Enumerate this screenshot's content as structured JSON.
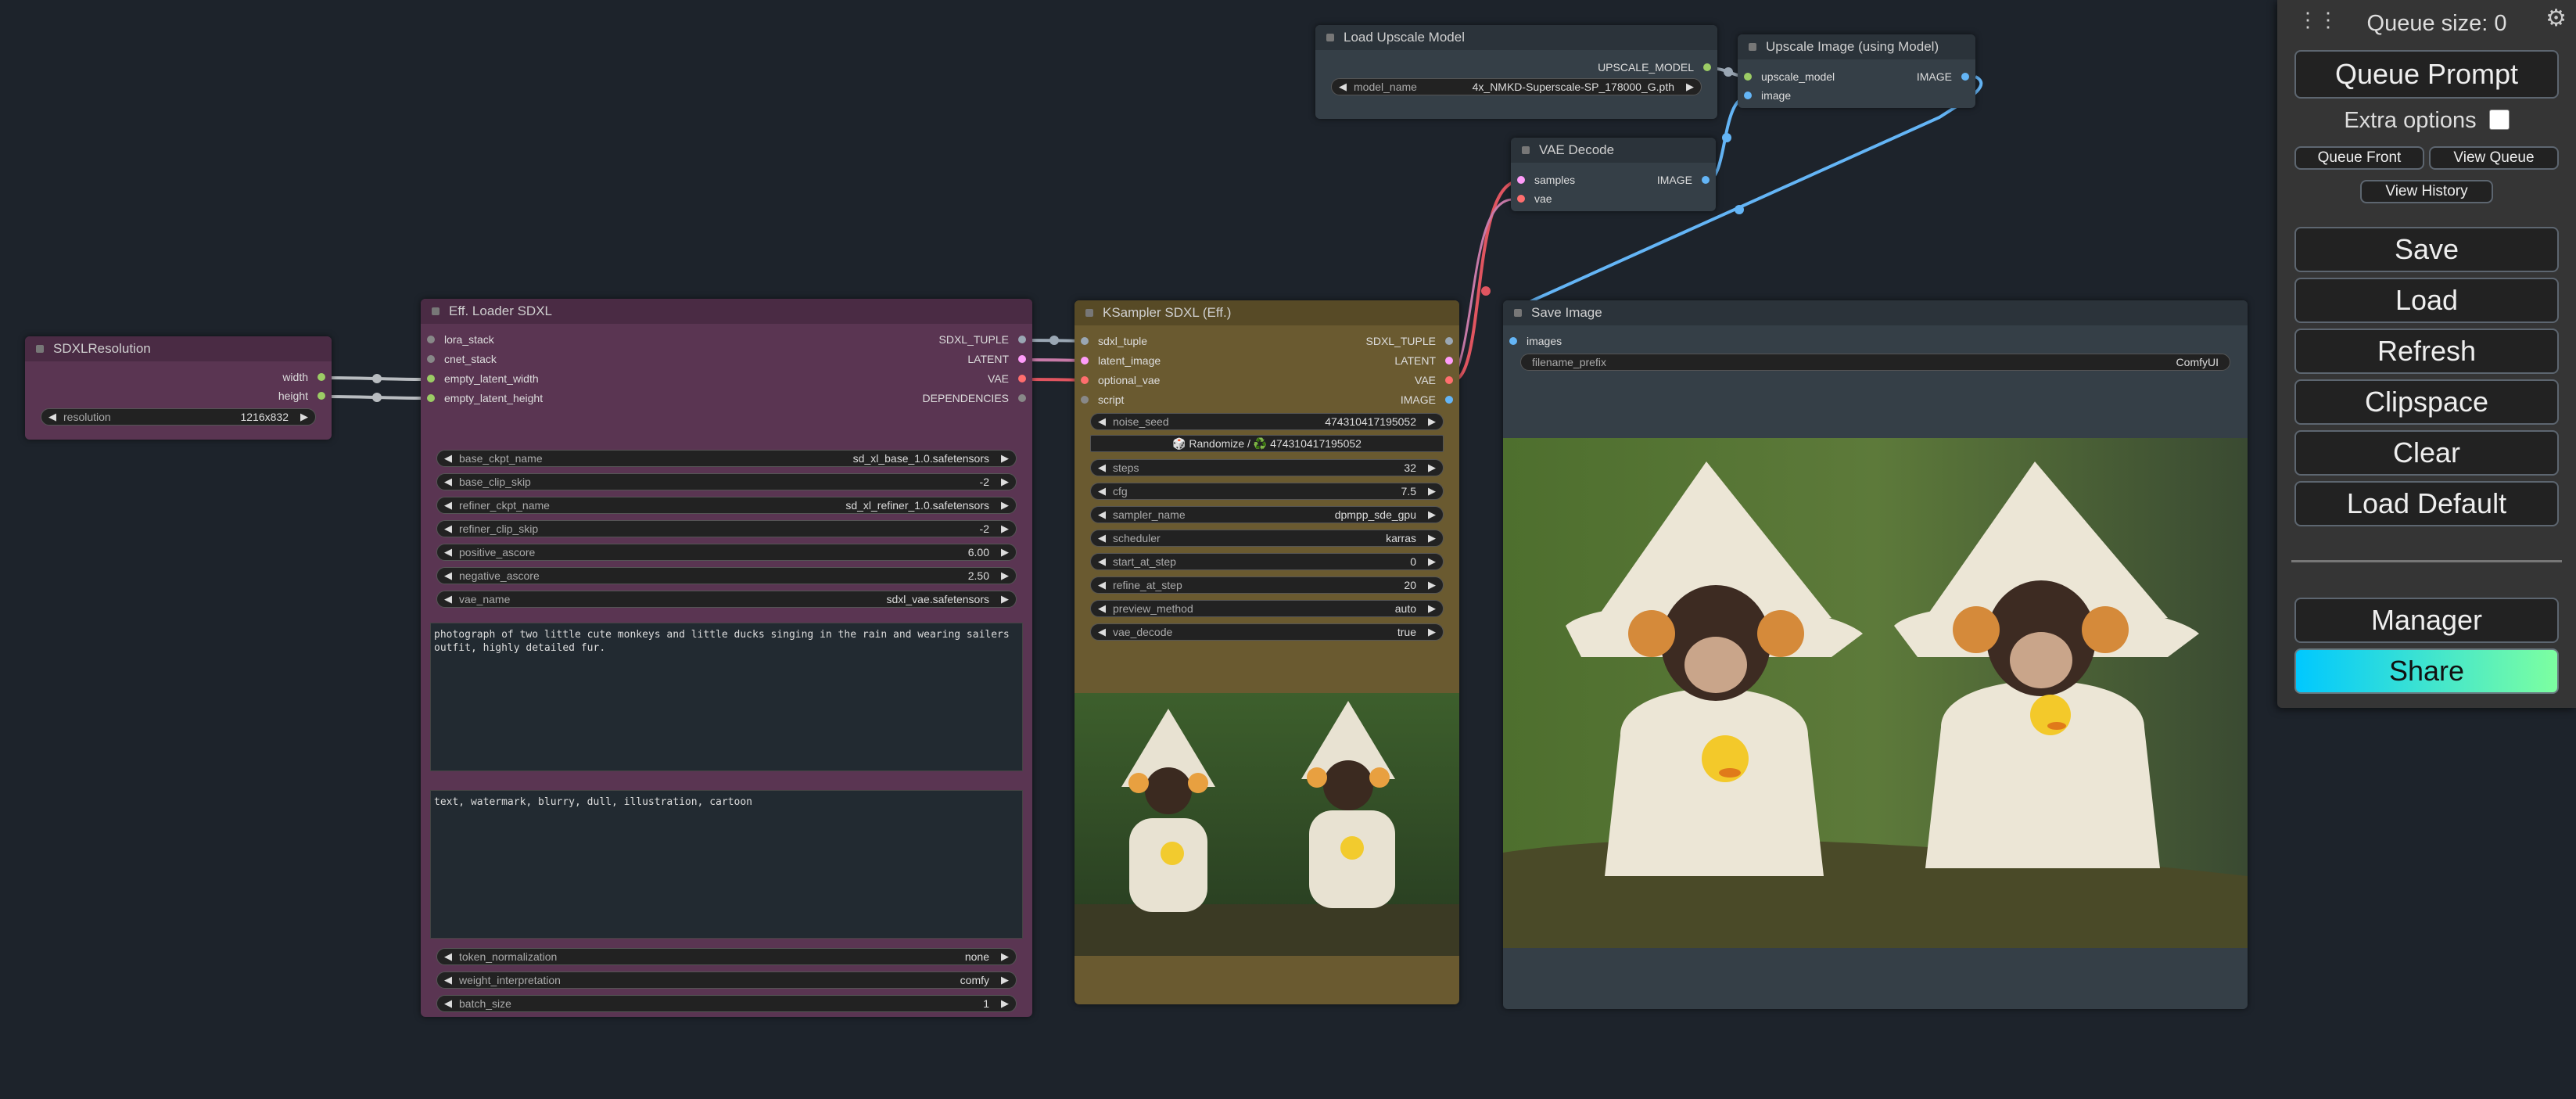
{
  "nodes": {
    "sdxl_resolution": {
      "title": "SDXLResolution",
      "outputs": [
        "width",
        "height"
      ],
      "widget": {
        "label": "resolution",
        "value": "1216x832"
      }
    },
    "eff_loader": {
      "title": "Eff. Loader SDXL",
      "inputs": [
        "lora_stack",
        "cnet_stack",
        "empty_latent_width",
        "empty_latent_height"
      ],
      "outputs": [
        "SDXL_TUPLE",
        "LATENT",
        "VAE",
        "DEPENDENCIES"
      ],
      "widgets": [
        {
          "label": "base_ckpt_name",
          "value": "sd_xl_base_1.0.safetensors"
        },
        {
          "label": "base_clip_skip",
          "value": "-2"
        },
        {
          "label": "refiner_ckpt_name",
          "value": "sd_xl_refiner_1.0.safetensors"
        },
        {
          "label": "refiner_clip_skip",
          "value": "-2"
        },
        {
          "label": "positive_ascore",
          "value": "6.00"
        },
        {
          "label": "negative_ascore",
          "value": "2.50"
        },
        {
          "label": "vae_name",
          "value": "sdxl_vae.safetensors"
        }
      ],
      "positive_prompt": "photograph of two little cute monkeys and little ducks singing in the rain and wearing sailers outfit, highly detailed fur.",
      "negative_prompt": "text, watermark, blurry, dull, illustration, cartoon",
      "widgets_bottom": [
        {
          "label": "token_normalization",
          "value": "none"
        },
        {
          "label": "weight_interpretation",
          "value": "comfy"
        },
        {
          "label": "batch_size",
          "value": "1"
        }
      ]
    },
    "ksampler": {
      "title": "KSampler SDXL (Eff.)",
      "inputs": [
        "sdxl_tuple",
        "latent_image",
        "optional_vae",
        "script"
      ],
      "outputs": [
        "SDXL_TUPLE",
        "LATENT",
        "VAE",
        "IMAGE"
      ],
      "seed_widget": {
        "label": "noise_seed",
        "value": "474310417195052"
      },
      "randomize_label": "🎲 Randomize / ♻️ 474310417195052",
      "widgets": [
        {
          "label": "steps",
          "value": "32"
        },
        {
          "label": "cfg",
          "value": "7.5"
        },
        {
          "label": "sampler_name",
          "value": "dpmpp_sde_gpu"
        },
        {
          "label": "scheduler",
          "value": "karras"
        },
        {
          "label": "start_at_step",
          "value": "0"
        },
        {
          "label": "refine_at_step",
          "value": "20"
        },
        {
          "label": "preview_method",
          "value": "auto"
        },
        {
          "label": "vae_decode",
          "value": "true"
        }
      ]
    },
    "load_upscale": {
      "title": "Load Upscale Model",
      "output": "UPSCALE_MODEL",
      "widget": {
        "label": "model_name",
        "value": "4x_NMKD-Superscale-SP_178000_G.pth"
      }
    },
    "upscale_image": {
      "title": "Upscale Image (using Model)",
      "inputs": [
        "upscale_model",
        "image"
      ],
      "output": "IMAGE"
    },
    "vae_decode": {
      "title": "VAE Decode",
      "inputs": [
        "samples",
        "vae"
      ],
      "output": "IMAGE"
    },
    "save_image": {
      "title": "Save Image",
      "input": "images",
      "widget": {
        "label": "filename_prefix",
        "value": "ComfyUI"
      }
    }
  },
  "menu": {
    "queue_size": "Queue size: 0",
    "queue_prompt": "Queue Prompt",
    "extra_options": "Extra options",
    "queue_front": "Queue Front",
    "view_queue": "View Queue",
    "view_history": "View History",
    "save": "Save",
    "load": "Load",
    "refresh": "Refresh",
    "clipspace": "Clipspace",
    "clear": "Clear",
    "load_default": "Load Default",
    "manager": "Manager",
    "share": "Share"
  },
  "colors": {
    "canvas": "#1d232b",
    "loader_node": "#5a3552",
    "ksampler_node": "#6a5a30",
    "generic_node": "#353f47",
    "share_gradient": [
      "#00c8ff",
      "#7dffa0"
    ]
  }
}
